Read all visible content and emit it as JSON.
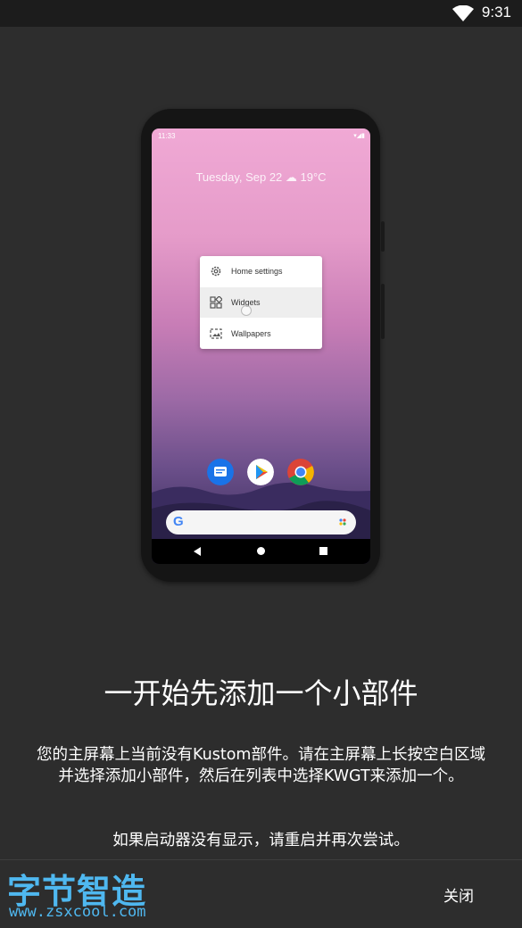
{
  "status_bar": {
    "time": "9:31",
    "wifi_icon": "wifi-icon"
  },
  "illustration": {
    "screen_time": "11:33",
    "date_weather": "Tuesday, Sep 22  ☁ 19°C",
    "menu_items": [
      {
        "label": "Home settings",
        "icon": "gear-icon"
      },
      {
        "label": "Widgets",
        "icon": "widgets-icon"
      },
      {
        "label": "Wallpapers",
        "icon": "wallpaper-icon"
      }
    ],
    "dock_apps": [
      "messages-icon",
      "play-store-icon",
      "chrome-icon"
    ],
    "search_letter": "G"
  },
  "title": "一开始先添加一个小部件",
  "description": "您的主屏幕上当前没有Kustom部件。请在主屏幕上长按空白区域并选择添加小部件，然后在列表中选择KWGT来添加一个。",
  "hint": "如果启动器没有显示，请重启并再次尝试。",
  "watermark": {
    "logo": "字节智造",
    "url": "www.zsxcool.com"
  },
  "buttons": {
    "close": "关闭"
  },
  "colors": {
    "background": "#2d2d2d",
    "watermark": "#4fb8f0"
  }
}
